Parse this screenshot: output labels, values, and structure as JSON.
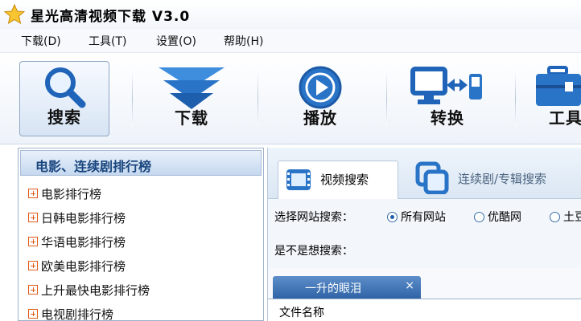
{
  "window": {
    "title": "星光高清视频下载  V3.0"
  },
  "menu": [
    "下载(D)",
    "工具(T)",
    "设置(O)",
    "帮助(H)"
  ],
  "toolbar": {
    "search_label": "搜索",
    "download_label": "下载",
    "play_label": "播放",
    "convert_label": "转换",
    "tools_label": "工具"
  },
  "left_panel": {
    "header": "电影、连续剧排行榜",
    "items": [
      "电影排行榜",
      "日韩电影排行榜",
      "华语电影排行榜",
      "欧美电影排行榜",
      "上升最快电影排行榜",
      "电视剧排行榜"
    ]
  },
  "right_panel": {
    "tabs": {
      "video_search": "视频搜索",
      "series_search": "连续剧/专辑搜索"
    },
    "site_label": "选择网站搜索：",
    "sites": {
      "all": "所有网站",
      "youku": "优酷网",
      "tudou": "土豆"
    },
    "suggest_label": "是不是想搜索：",
    "result_tab": "一升的眼泪",
    "result_tab_close": "×",
    "column_filename": "文件名称"
  },
  "colors": {
    "accent": "#2a74c8",
    "panel_header_text": "#17457d",
    "expand_icon": "#e05a18"
  }
}
